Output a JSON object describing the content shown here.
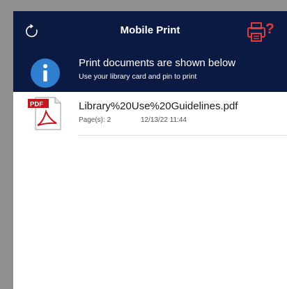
{
  "header": {
    "title": "Mobile Print",
    "refresh_icon": "refresh-icon",
    "help_icon": "printer-help-icon"
  },
  "info": {
    "icon": "info-icon",
    "title": "Print documents are shown below",
    "subtitle": "Use your library card and pin to print"
  },
  "documents": [
    {
      "icon": "pdf-file-icon",
      "name": "Library%20Use%20Guidelines.pdf",
      "pages": "Page(s): 2",
      "date": "12/13/22 11:44"
    }
  ],
  "colors": {
    "header_bg": "#0b1a43",
    "info_blue": "#2f7fd1",
    "pdf_red": "#c4161c",
    "help_red": "#e53935"
  }
}
